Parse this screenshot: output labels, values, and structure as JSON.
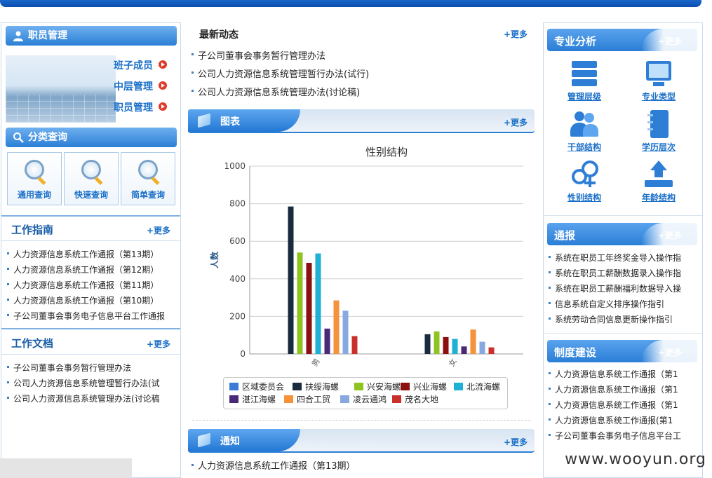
{
  "left": {
    "staff": {
      "title": "职员管理",
      "links": [
        "班子成员",
        "中层管理",
        "职员管理"
      ]
    },
    "query": {
      "title": "分类查询",
      "buttons": [
        "通用查询",
        "快速查询",
        "简单查询"
      ]
    },
    "guide": {
      "title": "工作指南",
      "more": "+更多",
      "items": [
        "人力资源信息系统工作通报（第13期）",
        "人力资源信息系统工作通报（第12期）",
        "人力资源信息系统工作通报（第11期）",
        "人力资源信息系统工作通报（第10期）",
        "子公司董事会事务电子信息平台工作通报"
      ]
    },
    "docs": {
      "title": "工作文档",
      "more": "+更多",
      "items": [
        "子公司董事会事务暂行管理办法",
        "公司人力资源信息系统管理暂行办法(试",
        "公司人力资源信息系统管理办法(讨论稿"
      ]
    }
  },
  "middle": {
    "news": {
      "title": "最新动态",
      "more": "+更多",
      "items": [
        "子公司董事会事务暂行管理办法",
        "公司人力资源信息系统管理暂行办法(试行)",
        "公司人力资源信息系统管理办法(讨论稿)"
      ]
    },
    "chart_section": {
      "title": "图表",
      "more": "+更多"
    },
    "notice": {
      "title": "通知",
      "more": "+更多",
      "items": [
        "人力资源信息系统工作通报（第13期）"
      ]
    }
  },
  "right": {
    "analysis": {
      "title": "专业分析",
      "more": "+更多",
      "items": [
        {
          "label": "管理层级",
          "icon": "server-stack-icon"
        },
        {
          "label": "专业类型",
          "icon": "monitor-icon"
        },
        {
          "label": "干部结构",
          "icon": "users-icon"
        },
        {
          "label": "学历层次",
          "icon": "notebook-icon"
        },
        {
          "label": "性别结构",
          "icon": "gender-icon"
        },
        {
          "label": "年龄结构",
          "icon": "upload-icon"
        }
      ]
    },
    "bulletin": {
      "title": "通报",
      "more": "+更多",
      "items": [
        "系统在职员工年终奖金导入操作指",
        "系统在职员工薪酬数据录入操作指",
        "系统在职员工薪酬福利数据导入操",
        "信息系统自定义排序操作指引",
        "系统劳动合同信息更新操作指引"
      ]
    },
    "system": {
      "title": "制度建设",
      "more": "+更多",
      "items": [
        "人力资源信息系统工作通报（第1",
        "人力资源信息系统工作通报（第1",
        "人力资源信息系统工作通报（第1",
        "人力资源信息系统工作通报(第1",
        "子公司董事会事务电子信息平台工"
      ]
    }
  },
  "watermark": "www.wooyun.org",
  "colors": {
    "brand_blue": "#2a7fd6",
    "link_blue": "#1a6fc8"
  },
  "chart_data": {
    "type": "bar",
    "title": "性别结构",
    "ylabel": "人数",
    "xlabel": "",
    "categories": [
      "男",
      "女"
    ],
    "ylim": [
      0,
      1000
    ],
    "yticks": [
      0,
      200,
      400,
      600,
      800,
      1000
    ],
    "grid": true,
    "legend_position": "bottom",
    "series": [
      {
        "name": "区域委员会",
        "color": "#3a7ad8",
        "values": [
          0,
          0
        ]
      },
      {
        "name": "扶绥海螺",
        "color": "#1a2a3f",
        "values": [
          785,
          105
        ]
      },
      {
        "name": "兴安海螺",
        "color": "#8fc31f",
        "values": [
          540,
          120
        ]
      },
      {
        "name": "兴业海螺",
        "color": "#8b1010",
        "values": [
          485,
          90
        ]
      },
      {
        "name": "北流海螺",
        "color": "#1fb0d6",
        "values": [
          535,
          80
        ]
      },
      {
        "name": "湛江海螺",
        "color": "#4a2a78",
        "values": [
          135,
          40
        ]
      },
      {
        "name": "四合工贸",
        "color": "#f6923a",
        "values": [
          285,
          130
        ]
      },
      {
        "name": "凌云通鸿",
        "color": "#88a8e0",
        "values": [
          230,
          65
        ]
      },
      {
        "name": "茂名大地",
        "color": "#c9302c",
        "values": [
          95,
          35
        ]
      }
    ]
  }
}
